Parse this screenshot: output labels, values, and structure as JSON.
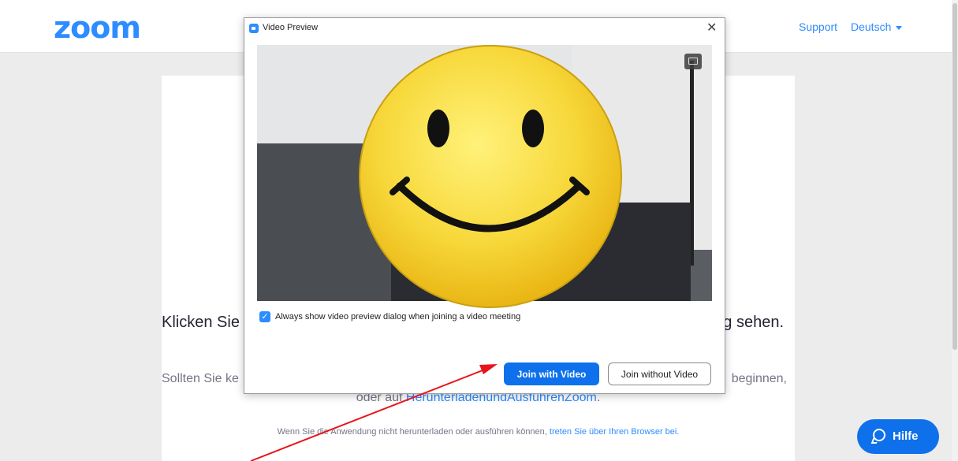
{
  "header": {
    "logo": "zoom",
    "support_label": "Support",
    "language_label": "Deutsch"
  },
  "content": {
    "line1_start": "Klicken Sie",
    "line1_end": "g sehen.",
    "line2_start": "Sollten Sie ke",
    "line2_end": "beginnen,",
    "line2b_prefix": "oder auf",
    "line2b_link": "HerunterladenundAusführenZoom",
    "line2b_suffix": ".",
    "line3_text": "Wenn Sie die Anwendung nicht herunterladen oder ausführen können,",
    "line3_link": "treten Sie über Ihren Browser bei."
  },
  "dialog": {
    "title": "Video Preview",
    "close_glyph": "✕",
    "checkbox_label": "Always show video preview dialog when joining a video meeting",
    "checkbox_checked": true,
    "join_with_video": "Join with Video",
    "join_without_video": "Join without Video"
  },
  "help": {
    "label": "Hilfe"
  },
  "colors": {
    "brand_blue": "#2D8CFF",
    "button_blue": "#0E71EB",
    "annotation_arrow": "#E8141C",
    "smiley_yellow": "#F7D83B"
  },
  "icons": [
    "zoom-logo",
    "caret-down-icon",
    "video-app-icon",
    "close-icon",
    "background-icon",
    "checkbox-checked-icon",
    "chat-bubble-icon",
    "smiley-icon",
    "arrow-annotation"
  ]
}
